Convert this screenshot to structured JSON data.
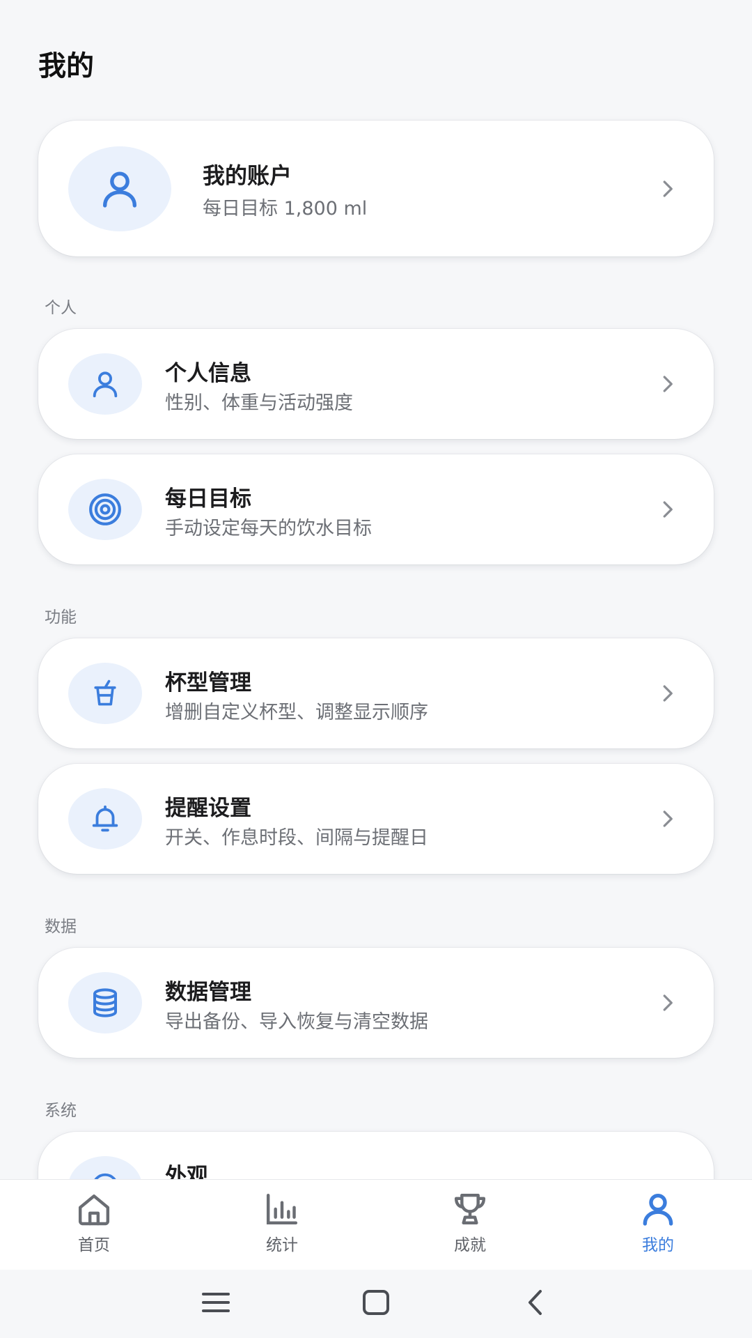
{
  "page": {
    "title": "我的"
  },
  "account": {
    "title": "我的账户",
    "subtitle": "每日目标 1,800 ml",
    "icon": "user-icon"
  },
  "sections": {
    "personal": "个人",
    "features": "功能",
    "data": "数据",
    "system": "系统"
  },
  "items": {
    "profile": {
      "title": "个人信息",
      "subtitle": "性别、体重与活动强度",
      "icon": "user-icon"
    },
    "goal": {
      "title": "每日目标",
      "subtitle": "手动设定每天的饮水目标",
      "icon": "target-icon"
    },
    "cups": {
      "title": "杯型管理",
      "subtitle": "增删自定义杯型、调整显示顺序",
      "icon": "cup-icon"
    },
    "reminder": {
      "title": "提醒设置",
      "subtitle": "开关、作息时段、间隔与提醒日",
      "icon": "bell-icon"
    },
    "data_mgmt": {
      "title": "数据管理",
      "subtitle": "导出备份、导入恢复与清空数据",
      "icon": "database-icon"
    },
    "appearance": {
      "title": "外观",
      "subtitle": "",
      "icon": "palette-icon"
    }
  },
  "tabs": [
    {
      "label": "首页",
      "icon": "home-icon"
    },
    {
      "label": "统计",
      "icon": "bar-chart-icon"
    },
    {
      "label": "成就",
      "icon": "trophy-icon"
    },
    {
      "label": "我的",
      "icon": "user-icon",
      "active": true
    }
  ],
  "colors": {
    "accent": "#3b7ddd",
    "icon_bg": "#eaf1fc",
    "background": "#f6f7f9"
  }
}
